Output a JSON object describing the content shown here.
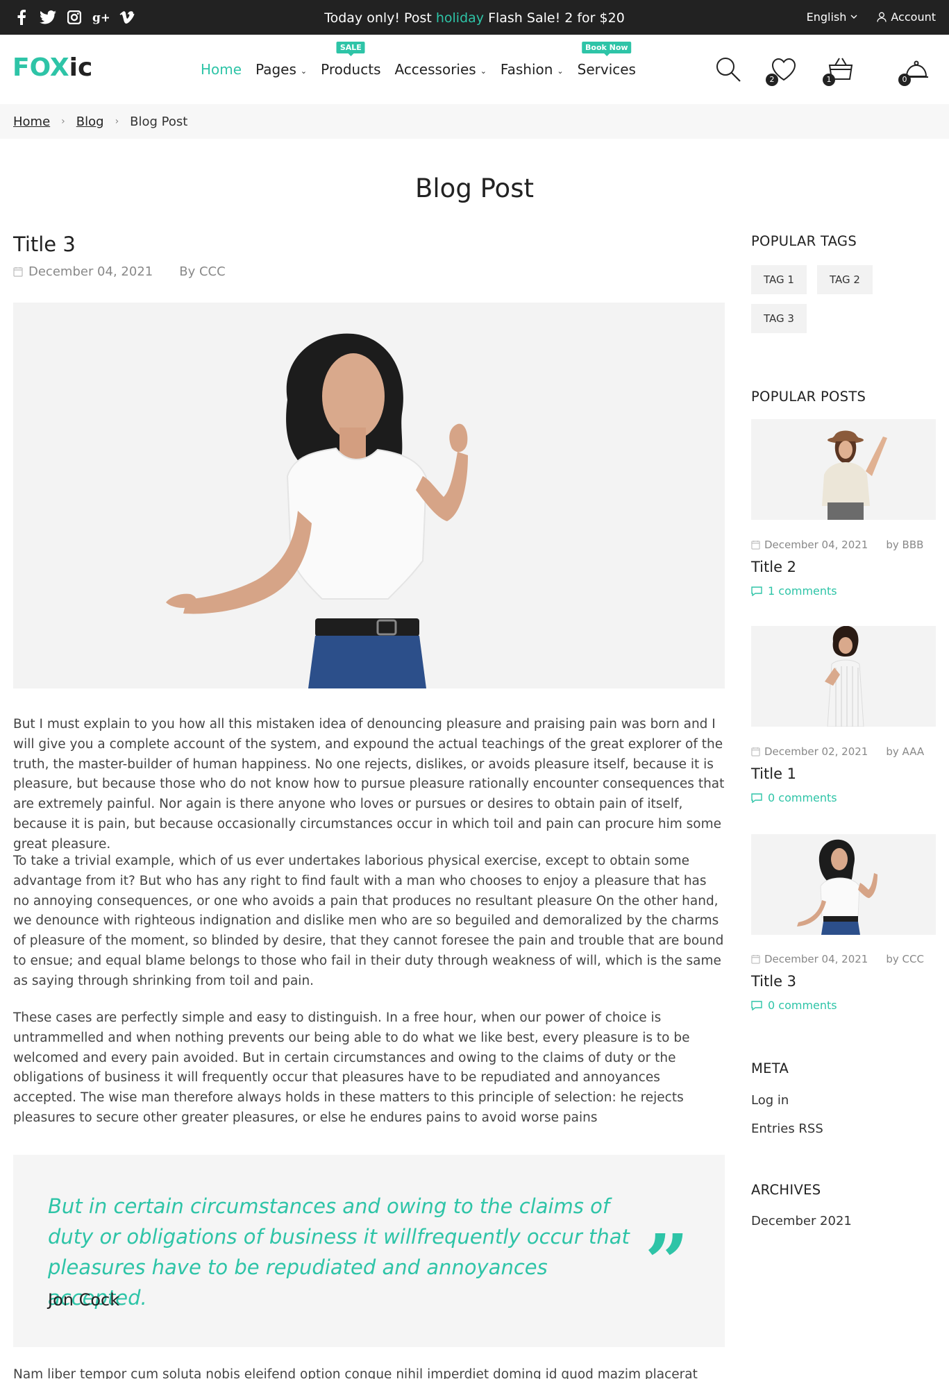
{
  "topbar": {
    "social_icons": [
      "facebook-icon",
      "twitter-icon",
      "instagram-icon",
      "google-plus-icon",
      "vimeo-icon"
    ],
    "promo_before": "Today only! Post",
    "promo_highlight": "holiday",
    "promo_after": "Flash Sale! 2 for $20",
    "language": "English",
    "account": "Account"
  },
  "header": {
    "logo_part1": "FOX",
    "logo_part2": "ic",
    "nav": [
      {
        "label": "Home"
      },
      {
        "label": "Pages"
      },
      {
        "label": "Products",
        "badge": "SALE"
      },
      {
        "label": "Accessories"
      },
      {
        "label": "Fashion"
      },
      {
        "label": "Services",
        "badge": "Book Now"
      }
    ],
    "wishlist_count": "2",
    "compare_count": "1",
    "cart_count": "0"
  },
  "breadcrumb": {
    "items": [
      "Home",
      "Blog"
    ],
    "current": "Blog Post"
  },
  "page_title": "Blog Post",
  "post": {
    "title": "Title 3",
    "date": "December 04, 2021",
    "author": "By CCC",
    "paragraphs": [
      "But I must explain to you how all this mistaken idea of denouncing pleasure and praising pain was born and I will give you a complete account of the system, and expound the actual teachings of the great explorer of the truth, the master-builder of human happiness. No one rejects, dislikes, or avoids pleasure itself, because it is pleasure, but because those who do not know how to pursue pleasure rationally encounter consequences that are extremely painful. Nor again is there anyone who loves or pursues or desires to obtain pain of itself, because it is pain, but because occasionally circumstances occur in which toil and pain can procure him some great pleasure.",
      "To take a trivial example, which of us ever undertakes laborious physical exercise, except to obtain some advantage from it? But who has any right to find fault with a man who chooses to enjoy a pleasure that has no annoying consequences, or one who avoids a pain that produces no resultant pleasure On the other hand, we denounce with righteous indignation and dislike men who are so beguiled and demoralized by the charms of pleasure of the moment, so blinded by desire, that they cannot foresee the pain and trouble that are bound to ensue; and equal blame belongs to those who fail in their duty through weakness of will, which is the same as saying through shrinking from toil and pain.",
      "These cases are perfectly simple and easy to distinguish. In a free hour, when our power of choice is untrammelled and when nothing prevents our being able to do what we like best, every pleasure is to be welcomed and every pain avoided. But in certain circumstances and owing to the claims of duty or the obligations of business it will frequently occur that pleasures have to be repudiated and annoyances accepted. The wise man therefore always holds in these matters to this principle of selection: he rejects pleasures to secure other greater pleasures, or else he endures pains to avoid worse pains"
    ],
    "quote_text": "But in certain circumstances and owing to the claims of duty or obligations of business it willfrequently occur that pleasures have to be repudiated and annoyances accepted.",
    "quote_author": "Jon Cock",
    "quote_mark": "”",
    "trailing_text": "Nam liber tempor cum soluta nobis eleifend option congue nihil imperdiet doming id quod mazim placerat facer possim assum."
  },
  "sidebar": {
    "tags_heading": "POPULAR TAGS",
    "tags": [
      "TAG 1",
      "TAG 2",
      "TAG 3"
    ],
    "posts_heading": "POPULAR POSTS",
    "posts": [
      {
        "date": "December 04, 2021",
        "author": "by BBB",
        "title": "Title 2",
        "comments": "1 comments"
      },
      {
        "date": "December 02, 2021",
        "author": "by AAA",
        "title": "Title 1",
        "comments": "0 comments"
      },
      {
        "date": "December 04, 2021",
        "author": "by CCC",
        "title": "Title 3",
        "comments": "0 comments"
      }
    ],
    "meta_heading": "META",
    "meta_links": [
      "Log in",
      "Entries RSS"
    ],
    "archives_heading": "ARCHIVES",
    "archives": [
      "December 2021"
    ]
  },
  "colors": {
    "accent": "#2ec4a7",
    "topbar_bg": "#222222",
    "panel_bg": "#f5f5f5"
  }
}
